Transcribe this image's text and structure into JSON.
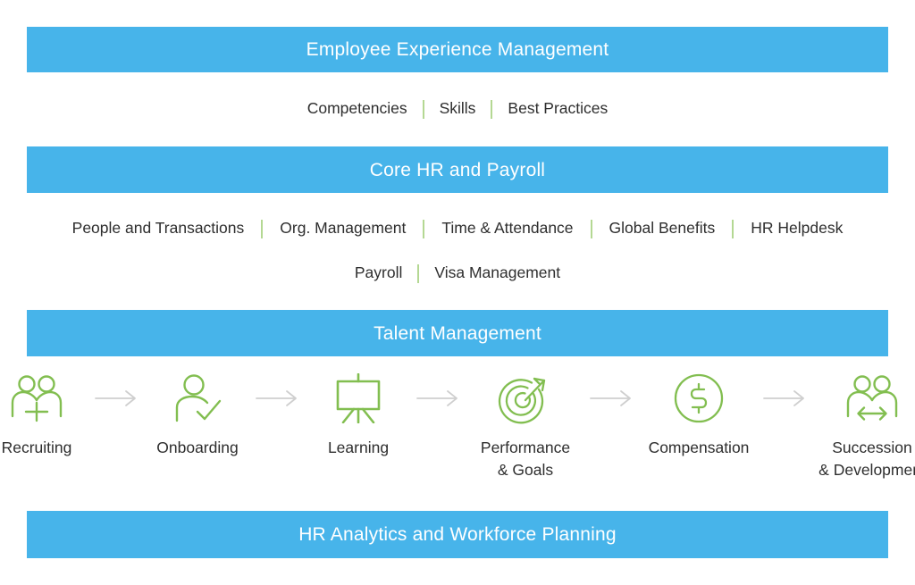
{
  "theme": {
    "banner_blue": "#47b4ea",
    "icon_green": "#82be50",
    "separator_green": "#b4d893",
    "arrow_gray": "#cfcfcf",
    "text_dark": "#2e2e2e",
    "banner_text": "#ffffff",
    "page_background": "#ffffff"
  },
  "sections": {
    "employee_experience": {
      "title": "Employee Experience Management",
      "items": [
        "Competencies",
        "Skills",
        "Best Practices"
      ]
    },
    "core_hr": {
      "title": "Core HR and Payroll",
      "items_row1": [
        "People and Transactions",
        "Org. Management",
        "Time & Attendance",
        "Global Benefits",
        "HR Helpdesk"
      ],
      "items_row2": [
        "Payroll",
        "Visa Management"
      ]
    },
    "talent": {
      "title": "Talent Management",
      "stages": [
        {
          "label": "Recruiting",
          "icon": "two-people-plus-icon"
        },
        {
          "label": "Onboarding",
          "icon": "person-check-icon"
        },
        {
          "label": "Learning",
          "icon": "easel-board-icon"
        },
        {
          "label": "Performance\n& Goals",
          "icon": "target-arrow-icon"
        },
        {
          "label": "Compensation",
          "icon": "dollar-circle-icon"
        },
        {
          "label": "Succession\n& Development",
          "icon": "two-people-arrows-icon"
        }
      ],
      "connector_icon": "arrow-right-icon"
    },
    "hr_analytics": {
      "title": "HR Analytics and Workforce Planning"
    }
  }
}
